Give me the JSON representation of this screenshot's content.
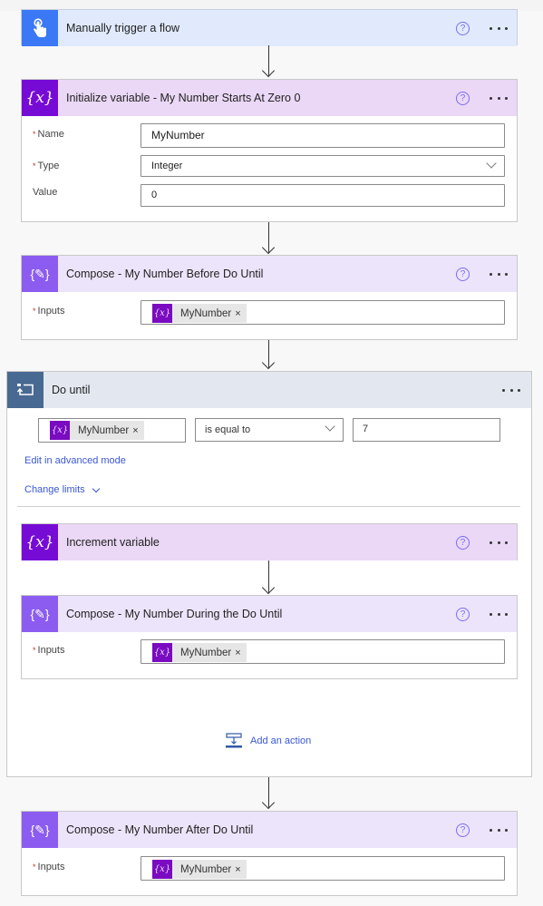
{
  "trigger": {
    "title": "Manually trigger a flow",
    "icon": "touch-hand-icon",
    "help_glyph": "?",
    "color_header": "#e0eafc",
    "color_icon": "#3b78f5"
  },
  "init_variable": {
    "title": "Initialize variable - My Number Starts At Zero 0",
    "icon_text": "{x}",
    "help_glyph": "?",
    "fields": {
      "name_label": "Name",
      "name_value": "MyNumber",
      "type_label": "Type",
      "type_value": "Integer",
      "value_label": "Value",
      "value_value": "0"
    },
    "required_marker": "*"
  },
  "compose_before": {
    "title": "Compose - My Number Before Do Until",
    "inputs_label": "Inputs",
    "token": "MyNumber",
    "token_icon": "{x}",
    "token_remove": "×",
    "help_glyph": "?"
  },
  "do_until": {
    "title": "Do until",
    "condition": {
      "left_token": "MyNumber",
      "token_icon": "{x}",
      "token_remove": "×",
      "operator": "is equal to",
      "right_value": "7"
    },
    "edit_advanced_label": "Edit in advanced mode",
    "change_limits_label": "Change limits",
    "increment": {
      "title": "Increment variable",
      "icon_text": "{x}",
      "help_glyph": "?"
    },
    "compose_during": {
      "title": "Compose - My Number During the Do Until",
      "inputs_label": "Inputs",
      "token": "MyNumber",
      "token_icon": "{x}",
      "token_remove": "×",
      "help_glyph": "?"
    },
    "add_action_label": "Add an action"
  },
  "compose_after": {
    "title": "Compose - My Number After Do Until",
    "inputs_label": "Inputs",
    "token": "MyNumber",
    "token_icon": "{x}",
    "token_remove": "×",
    "help_glyph": "?"
  },
  "colors": {
    "variable_purple": "#770bd6",
    "compose_purple": "#8c5cf0",
    "variable_header": "#ead8f6",
    "compose_header": "#ece4fb",
    "do_until_header": "#e3e8f0",
    "do_until_icon": "#486991",
    "link_blue": "#3a57d6"
  }
}
